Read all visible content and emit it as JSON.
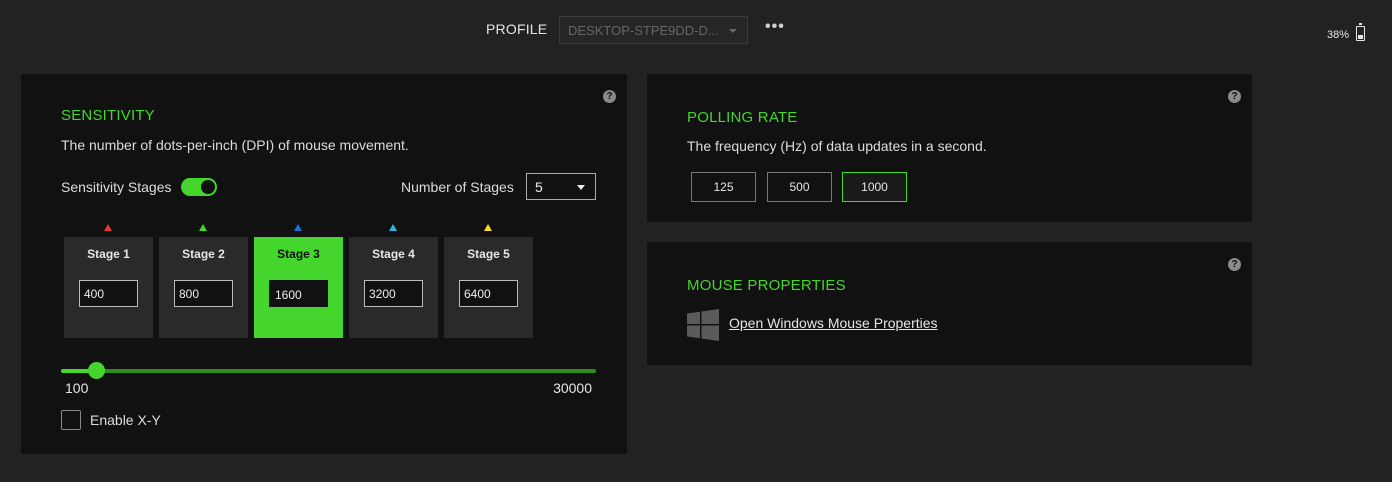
{
  "header": {
    "profile_label": "PROFILE",
    "profile_value": "DESKTOP-STPE9DD-D...",
    "more_icon": "more-dots-icon",
    "battery_text": "38%",
    "battery_level": 0.38
  },
  "sensitivity": {
    "title": "SENSITIVITY",
    "description": "The number of dots-per-inch (DPI) of mouse movement.",
    "stages_toggle_label": "Sensitivity Stages",
    "stages_toggle_on": true,
    "num_stages_label": "Number of Stages",
    "num_stages_value": "5",
    "stages": [
      {
        "name": "Stage 1",
        "value": "400",
        "color": "#e53935",
        "active": false
      },
      {
        "name": "Stage 2",
        "value": "800",
        "color": "#44d62c",
        "active": false
      },
      {
        "name": "Stage 3",
        "value": "1600",
        "color": "#1e6fe0",
        "active": true
      },
      {
        "name": "Stage 4",
        "value": "3200",
        "color": "#29b6d9",
        "active": false
      },
      {
        "name": "Stage 5",
        "value": "6400",
        "color": "#f2e11c",
        "active": false
      }
    ],
    "slider_min": "100",
    "slider_max": "30000",
    "xy_label": "Enable X-Y",
    "xy_checked": false
  },
  "polling": {
    "title": "POLLING RATE",
    "description": "The frequency (Hz) of data updates in a second.",
    "rates": [
      "125",
      "500",
      "1000"
    ],
    "selected": "1000"
  },
  "mouse_properties": {
    "title": "MOUSE PROPERTIES",
    "link_label": "Open Windows Mouse Properties",
    "icon": "windows-logo-icon"
  },
  "colors": {
    "accent": "#44d62c",
    "panel_bg": "#111111",
    "page_bg": "#222222"
  }
}
